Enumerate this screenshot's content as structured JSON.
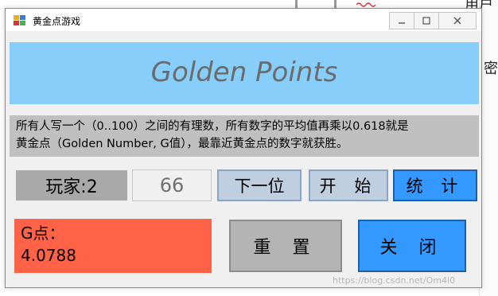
{
  "window": {
    "title": "黄金点游戏",
    "icon": "app-icon",
    "controls": {
      "minimize": "minimize-icon",
      "maximize": "maximize-icon",
      "close": "close-icon"
    }
  },
  "banner": {
    "title": "Golden Points",
    "background": "#87cefa"
  },
  "description": {
    "text": "所有人写一个（0..100）之间的有理数，所有数字的平均值再乘以0.618就是\n黄金点（Golden Number, G值），最靠近黄金点的数字就获胜。"
  },
  "controls": {
    "player_label": "玩家:2",
    "number_value": "66",
    "next_label": "下一位",
    "start_label": "开 始",
    "stats_label": "统 计"
  },
  "result": {
    "g_label": "G点：",
    "g_value": "4.0788",
    "background": "#ff6347"
  },
  "actions": {
    "reset_label": "重 置",
    "close_label": "关 闭"
  },
  "background_page": {
    "top_text": "用户",
    "mid_text": "密"
  },
  "watermark": "https://blog.csdn.net/Om4l0"
}
